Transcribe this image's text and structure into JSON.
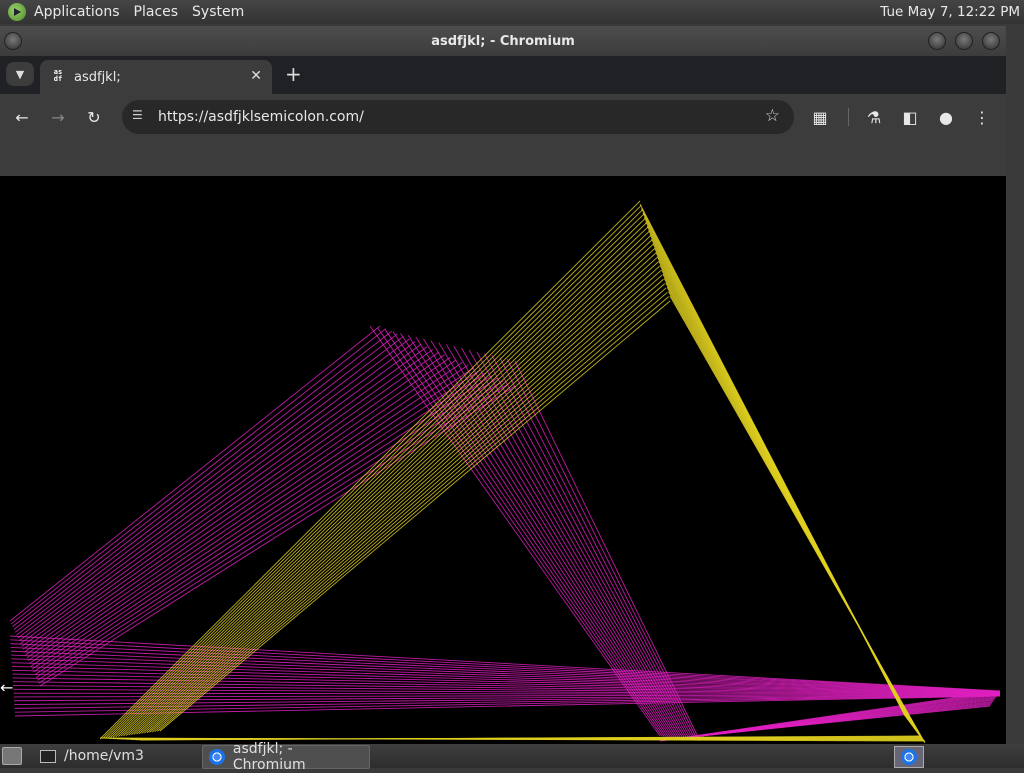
{
  "top_panel": {
    "menu": [
      "Applications",
      "Places",
      "System"
    ],
    "clock": "Tue May  7, 12:22 PM"
  },
  "window": {
    "title": "asdfjkl; - Chromium"
  },
  "browser": {
    "tab": {
      "title": "asdfjkl;",
      "favicon_text": "as df"
    },
    "url": "https://asdfjklsemicolon.com/"
  },
  "taskbar": {
    "tasks": [
      {
        "label": "/home/vm3",
        "active": false
      },
      {
        "label": "asdfjkl; - Chromium",
        "active": true
      }
    ]
  },
  "colors": {
    "magenta": "#e020c0",
    "yellow": "#e0d020"
  }
}
